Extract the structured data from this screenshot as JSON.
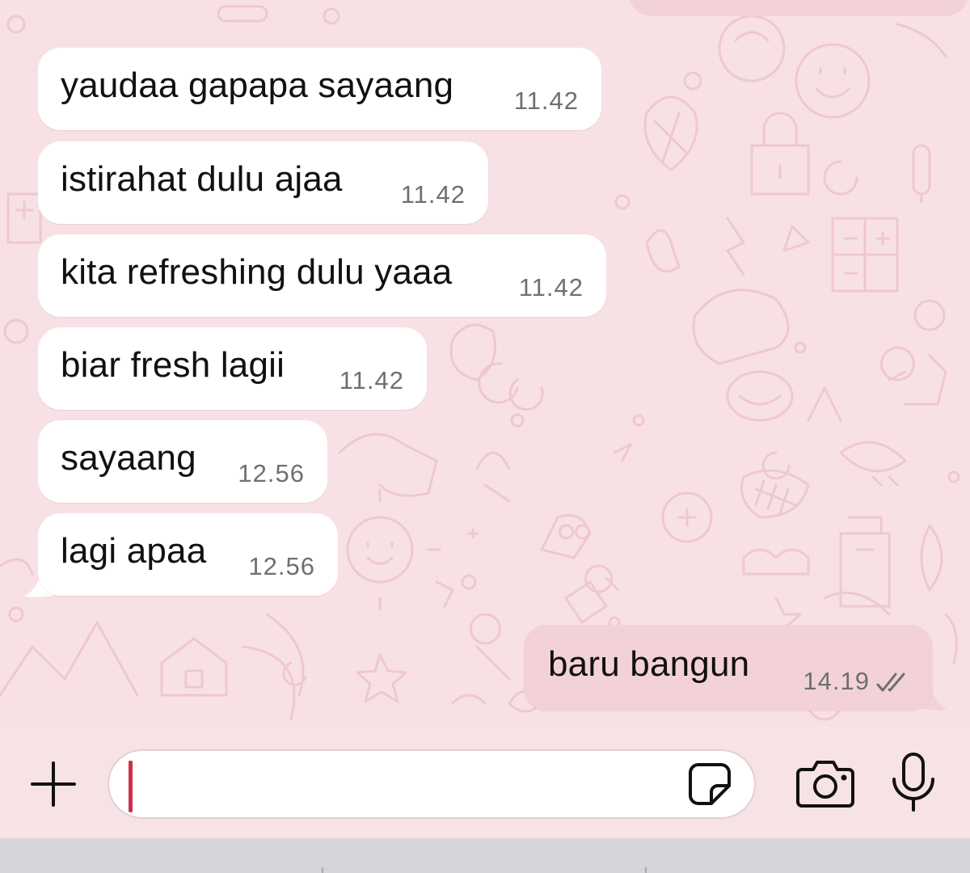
{
  "messages": [
    {
      "direction": "incoming",
      "text": "yaudaa gapapa sayaang",
      "time": "11.42"
    },
    {
      "direction": "incoming",
      "text": "istirahat dulu ajaa",
      "time": "11.42"
    },
    {
      "direction": "incoming",
      "text": "kita refreshing dulu yaaa",
      "time": "11.42"
    },
    {
      "direction": "incoming",
      "text": "biar fresh lagii",
      "time": "11.42"
    },
    {
      "direction": "incoming",
      "text": "sayaang",
      "time": "12.56"
    },
    {
      "direction": "incoming",
      "text": "lagi apaa",
      "time": "12.56"
    },
    {
      "direction": "outgoing",
      "text": "baru bangun",
      "time": "14.19",
      "status": "read"
    }
  ],
  "input": {
    "value": "",
    "left_icon": "plus-icon",
    "right_icons": [
      "sticker-icon",
      "camera-icon",
      "microphone-icon"
    ]
  },
  "colors": {
    "wallpaper": "#f8e1e5",
    "incoming_bubble": "#ffffff",
    "outgoing_bubble": "#f2d2d8",
    "caret": "#d2304a",
    "time_text": "#6f6f6f"
  }
}
